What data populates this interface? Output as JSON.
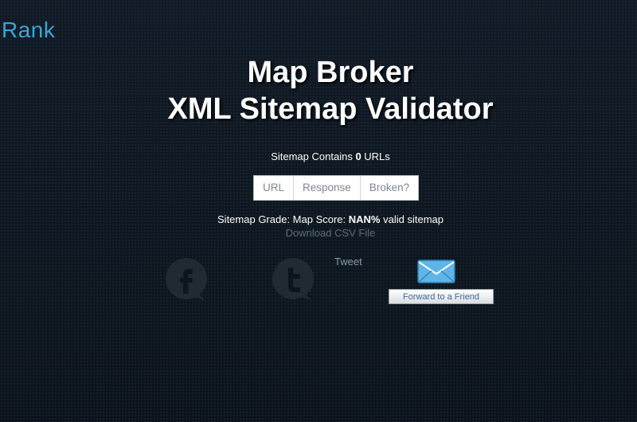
{
  "header": {
    "logo_text": "Rank"
  },
  "main": {
    "title_line1": "Map Broker",
    "title_line2": "XML Sitemap Validator",
    "contains_prefix": "Sitemap Contains ",
    "url_count": "0",
    "contains_suffix": " URLs",
    "table_headers": [
      "URL",
      "Response",
      "Broken?"
    ],
    "grade_prefix": "Sitemap Grade: Map Score: ",
    "grade_value": "NAN%",
    "grade_suffix": " valid sitemap",
    "download_link": "Download CSV File"
  },
  "share": {
    "tweet_label": "Tweet",
    "forward_label": "Forward to a Friend",
    "icons": [
      "facebook-icon",
      "twitter-icon",
      "envelope-icon"
    ]
  },
  "colors": {
    "background": "#0c131b",
    "logo": "#3aa6d6",
    "link": "#5a6d7d",
    "forward_text": "#3b6a9a"
  }
}
